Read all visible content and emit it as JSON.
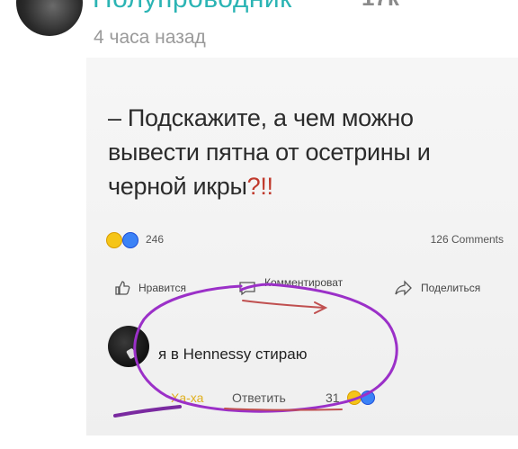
{
  "post": {
    "author_name": "Полупроводник",
    "author_count": "17к",
    "time_ago": "4 часа назад"
  },
  "meme": {
    "question_text": "– Подскажите, а чем можно вывести пятна от осетрины и черной икры",
    "question_punct": "?!!",
    "reactions_count": "246",
    "comments_count": "126 Comments",
    "actions": {
      "like": "Нравится",
      "comment": "Комментироват",
      "share": "Поделиться"
    },
    "comment": {
      "text": "я в Hennessy стираю",
      "haha": "Ха-ха",
      "reply": "Ответить",
      "reaction_count": "31"
    }
  },
  "colors": {
    "author": "#2bb4b4",
    "marker": "#9b30c8",
    "background": "#ffffff"
  },
  "icons": [
    "thumbs-up-icon",
    "comment-bubble-icon",
    "share-arrow-icon",
    "haha-emoji-icon",
    "like-emoji-icon"
  ]
}
